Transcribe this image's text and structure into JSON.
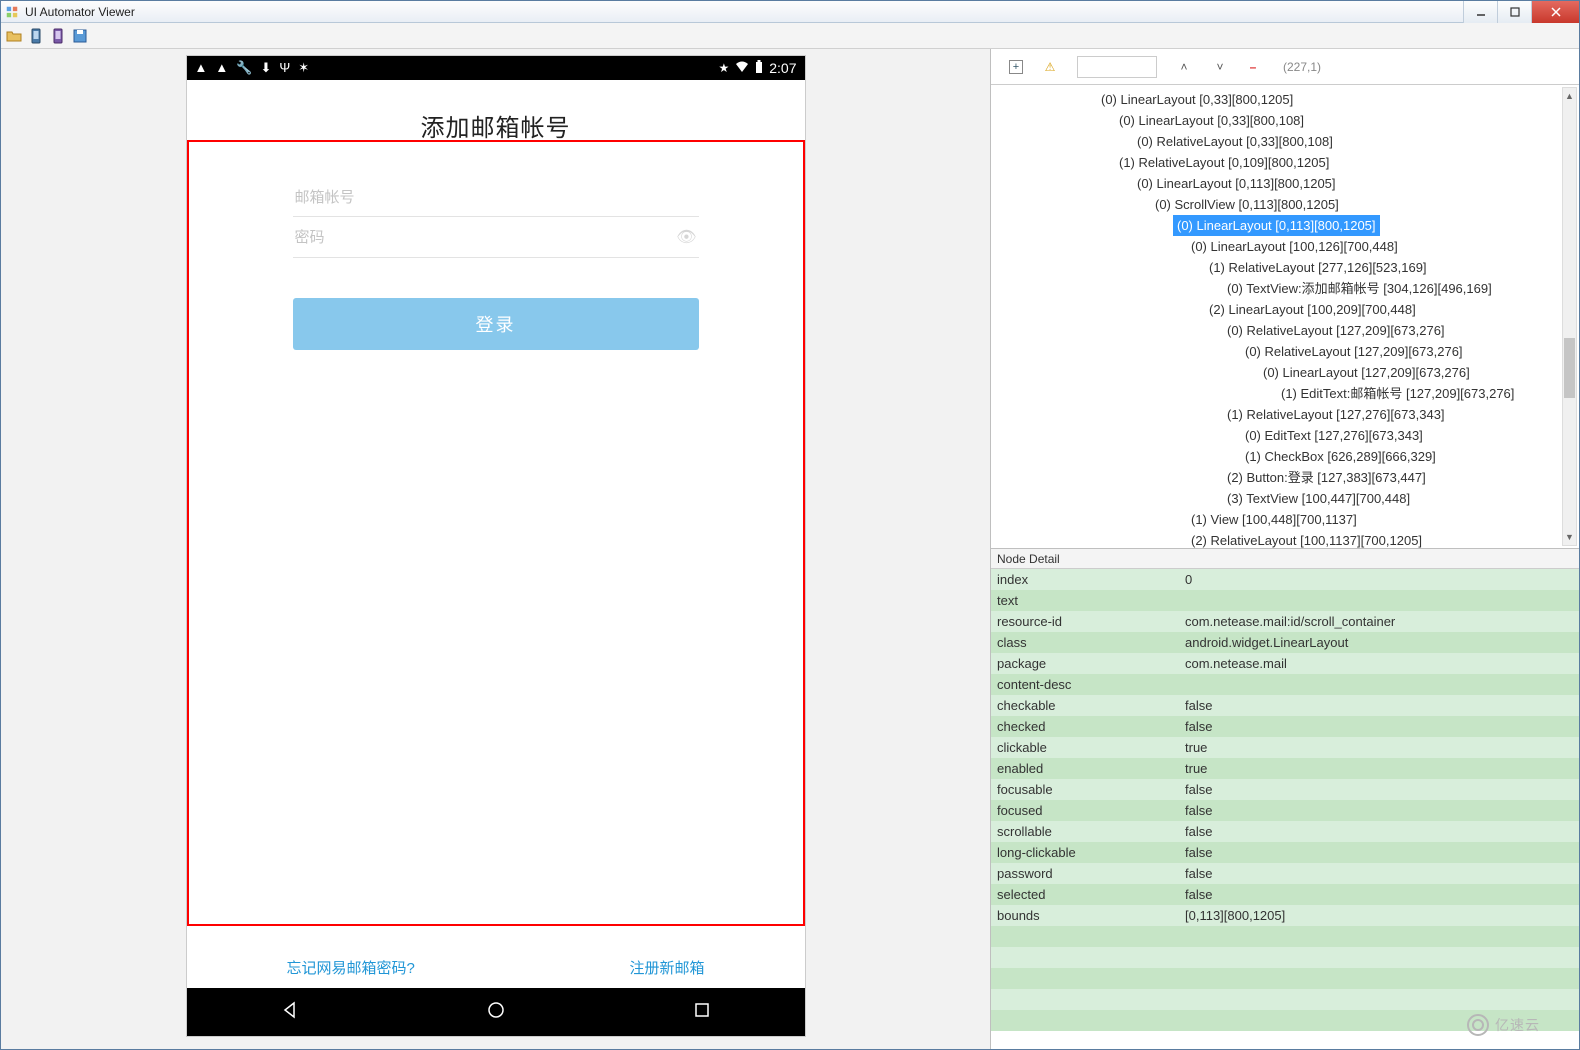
{
  "window": {
    "title": "UI Automator Viewer"
  },
  "status_bar": {
    "time": "2:07"
  },
  "form": {
    "title": "添加邮箱帐号",
    "email_placeholder": "邮箱帐号",
    "password_placeholder": "密码",
    "login_label": "登录",
    "forgot_label": "忘记网易邮箱密码?",
    "register_label": "注册新邮箱"
  },
  "tree_toolbar": {
    "coords": "(227,1)"
  },
  "tree": [
    {
      "indent": 110,
      "text": "(0) LinearLayout [0,33][800,1205]"
    },
    {
      "indent": 128,
      "text": "(0) LinearLayout [0,33][800,108]"
    },
    {
      "indent": 146,
      "text": "(0) RelativeLayout [0,33][800,108]"
    },
    {
      "indent": 128,
      "text": "(1) RelativeLayout [0,109][800,1205]"
    },
    {
      "indent": 146,
      "text": "(0) LinearLayout [0,113][800,1205]"
    },
    {
      "indent": 164,
      "text": "(0) ScrollView [0,113][800,1205]"
    },
    {
      "indent": 182,
      "text": "(0) LinearLayout [0,113][800,1205]",
      "selected": true
    },
    {
      "indent": 200,
      "text": "(0) LinearLayout [100,126][700,448]"
    },
    {
      "indent": 218,
      "text": "(1) RelativeLayout [277,126][523,169]"
    },
    {
      "indent": 236,
      "text": "(0) TextView:添加邮箱帐号 [304,126][496,169]"
    },
    {
      "indent": 218,
      "text": "(2) LinearLayout [100,209][700,448]"
    },
    {
      "indent": 236,
      "text": "(0) RelativeLayout [127,209][673,276]"
    },
    {
      "indent": 254,
      "text": "(0) RelativeLayout [127,209][673,276]"
    },
    {
      "indent": 272,
      "text": "(0) LinearLayout [127,209][673,276]"
    },
    {
      "indent": 290,
      "text": "(1) EditText:邮箱帐号 [127,209][673,276]"
    },
    {
      "indent": 236,
      "text": "(1) RelativeLayout [127,276][673,343]"
    },
    {
      "indent": 254,
      "text": "(0) EditText [127,276][673,343]"
    },
    {
      "indent": 254,
      "text": "(1) CheckBox [626,289][666,329]"
    },
    {
      "indent": 236,
      "text": "(2) Button:登录 [127,383][673,447]"
    },
    {
      "indent": 236,
      "text": "(3) TextView [100,447][700,448]"
    },
    {
      "indent": 200,
      "text": "(1) View [100,448][700,1137]"
    },
    {
      "indent": 200,
      "text": "(2) RelativeLayout [100,1137][700,1205]"
    }
  ],
  "detail_header": "Node Detail",
  "details": [
    {
      "k": "index",
      "v": "0"
    },
    {
      "k": "text",
      "v": ""
    },
    {
      "k": "resource-id",
      "v": "com.netease.mail:id/scroll_container"
    },
    {
      "k": "class",
      "v": "android.widget.LinearLayout"
    },
    {
      "k": "package",
      "v": "com.netease.mail"
    },
    {
      "k": "content-desc",
      "v": ""
    },
    {
      "k": "checkable",
      "v": "false"
    },
    {
      "k": "checked",
      "v": "false"
    },
    {
      "k": "clickable",
      "v": "true"
    },
    {
      "k": "enabled",
      "v": "true"
    },
    {
      "k": "focusable",
      "v": "false"
    },
    {
      "k": "focused",
      "v": "false"
    },
    {
      "k": "scrollable",
      "v": "false"
    },
    {
      "k": "long-clickable",
      "v": "false"
    },
    {
      "k": "password",
      "v": "false"
    },
    {
      "k": "selected",
      "v": "false"
    },
    {
      "k": "bounds",
      "v": "[0,113][800,1205]"
    }
  ],
  "watermark": "亿速云"
}
